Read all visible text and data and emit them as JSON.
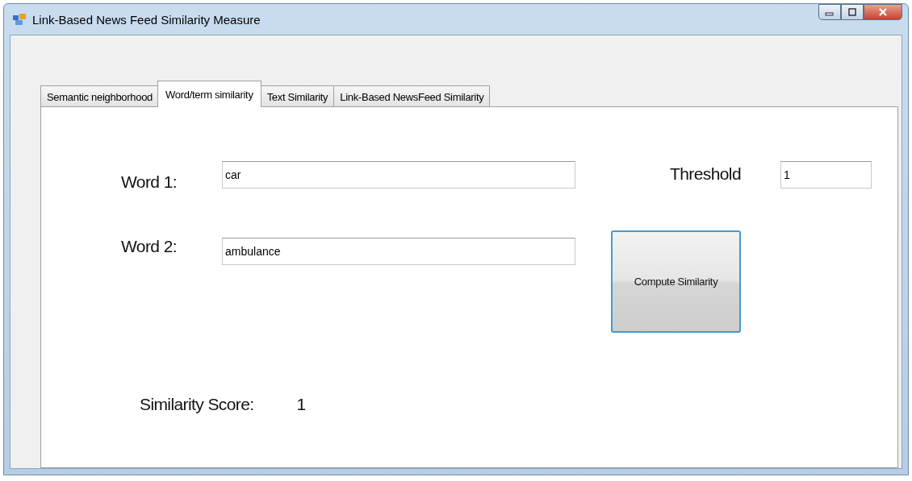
{
  "window": {
    "title": "Link-Based News Feed Similarity Measure"
  },
  "tabs": [
    {
      "label": "Semantic neighborhood",
      "selected": false
    },
    {
      "label": "Word/term similarity",
      "selected": true
    },
    {
      "label": "Text Similarity",
      "selected": false
    },
    {
      "label": "Link-Based NewsFeed Similarity",
      "selected": false
    }
  ],
  "form": {
    "word1": {
      "label": "Word 1:",
      "value": "car"
    },
    "word2": {
      "label": "Word 2:",
      "value": "ambulance"
    },
    "threshold": {
      "label": "Threshold",
      "value": "1"
    },
    "compute_button": "Compute Similarity",
    "score": {
      "label": "Similarity Score:",
      "value": "1"
    }
  }
}
